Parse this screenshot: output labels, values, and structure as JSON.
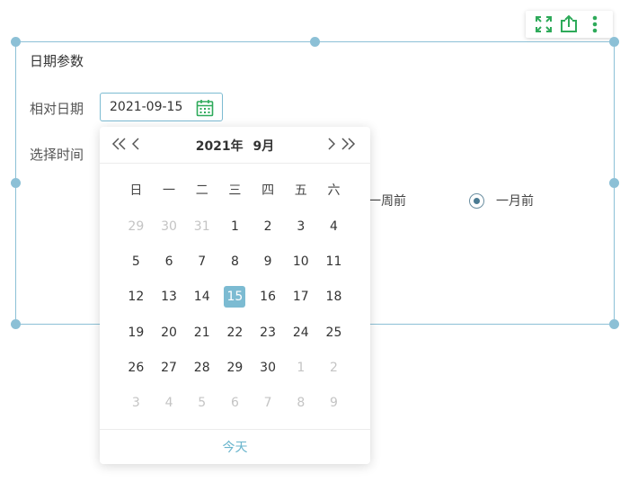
{
  "toolbar": {
    "icons": [
      "expand-icon",
      "export-icon",
      "more-vertical-icon"
    ],
    "accent": "#2eaa5a"
  },
  "widget": {
    "title": "日期参数",
    "relative_date_label": "相对日期",
    "date_value": "2021-09-15",
    "select_time_label": "选择时间",
    "options": [
      {
        "label": "一周前",
        "selected": false
      },
      {
        "label": "一月前",
        "selected": true
      }
    ],
    "frame_color": "#8cc0d6"
  },
  "calendar": {
    "prev_year": "<<",
    "prev_month": "<",
    "next_month": ">",
    "next_year": ">>",
    "year_label": "2021年",
    "month_label": "9月",
    "weekdays": [
      "日",
      "一",
      "二",
      "三",
      "四",
      "五",
      "六"
    ],
    "weeks": [
      [
        {
          "d": "29",
          "o": true
        },
        {
          "d": "30",
          "o": true
        },
        {
          "d": "31",
          "o": true
        },
        {
          "d": "1"
        },
        {
          "d": "2"
        },
        {
          "d": "3"
        },
        {
          "d": "4"
        }
      ],
      [
        {
          "d": "5"
        },
        {
          "d": "6"
        },
        {
          "d": "7"
        },
        {
          "d": "8"
        },
        {
          "d": "9"
        },
        {
          "d": "10"
        },
        {
          "d": "11"
        }
      ],
      [
        {
          "d": "12"
        },
        {
          "d": "13"
        },
        {
          "d": "14"
        },
        {
          "d": "15",
          "s": true
        },
        {
          "d": "16"
        },
        {
          "d": "17"
        },
        {
          "d": "18"
        }
      ],
      [
        {
          "d": "19"
        },
        {
          "d": "20"
        },
        {
          "d": "21"
        },
        {
          "d": "22"
        },
        {
          "d": "23"
        },
        {
          "d": "24"
        },
        {
          "d": "25"
        }
      ],
      [
        {
          "d": "26"
        },
        {
          "d": "27"
        },
        {
          "d": "28"
        },
        {
          "d": "29"
        },
        {
          "d": "30"
        },
        {
          "d": "1",
          "o": true
        },
        {
          "d": "2",
          "o": true
        }
      ],
      [
        {
          "d": "3",
          "o": true
        },
        {
          "d": "4",
          "o": true
        },
        {
          "d": "5",
          "o": true
        },
        {
          "d": "6",
          "o": true
        },
        {
          "d": "7",
          "o": true
        },
        {
          "d": "8",
          "o": true
        },
        {
          "d": "9",
          "o": true
        }
      ]
    ],
    "today_label": "今天",
    "selected_color": "#7cbbd2"
  }
}
